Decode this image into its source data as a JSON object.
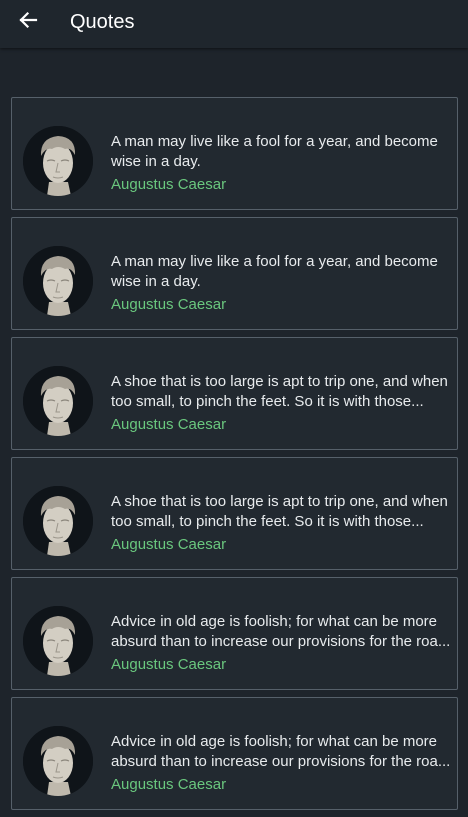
{
  "header": {
    "back_icon": "arrow-left-icon",
    "title": "Quotes"
  },
  "quotes": [
    {
      "text": "A man may live like a fool for a year, and become wise in a day.",
      "author": "Augustus Caesar"
    },
    {
      "text": "A man may live like a fool for a year, and become wise in a day.",
      "author": "Augustus Caesar"
    },
    {
      "text": "A shoe that is too large is apt to trip one, and when too small, to pinch the feet. So it is with those...",
      "author": "Augustus Caesar"
    },
    {
      "text": "A shoe that is too large is apt to trip one, and when too small, to pinch the feet. So it is with those...",
      "author": "Augustus Caesar"
    },
    {
      "text": "Advice in old age is foolish; for what can be more absurd than to increase our provisions for the roa...",
      "author": "Augustus Caesar"
    },
    {
      "text": "Advice in old age is foolish; for what can be more absurd than to increase our provisions for the roa...",
      "author": "Augustus Caesar"
    }
  ],
  "colors": {
    "background": "#1e242b",
    "card_border": "#56606a",
    "author_accent": "#6ac77e",
    "text": "#e8ebed"
  }
}
